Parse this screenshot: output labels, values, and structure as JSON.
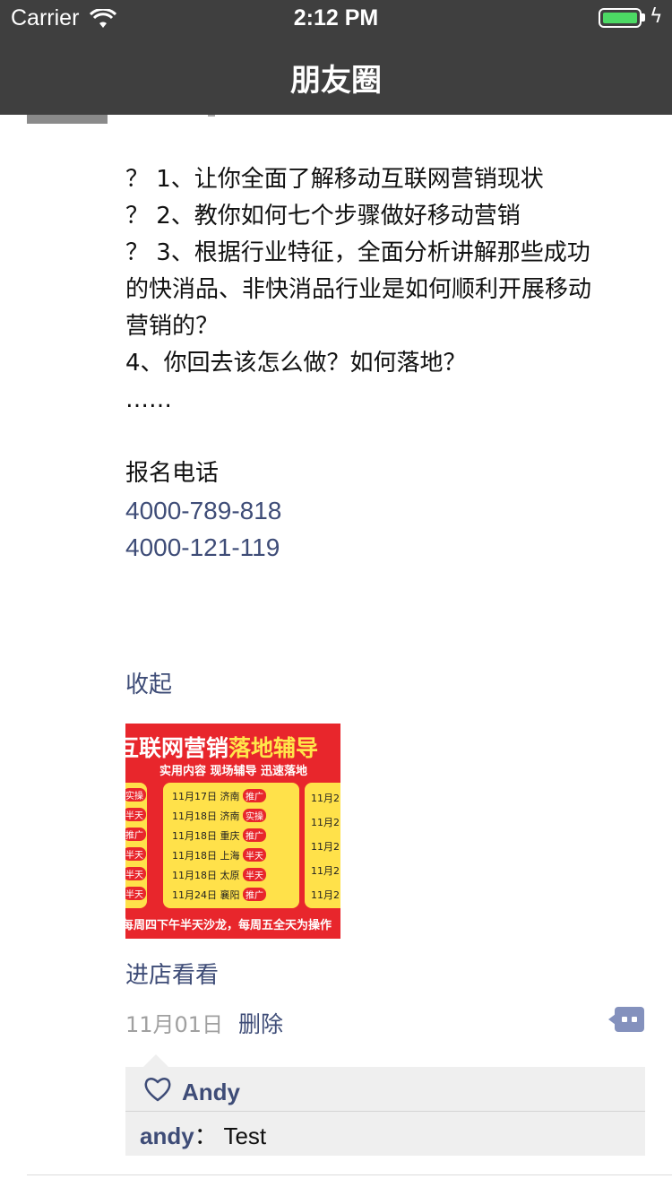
{
  "status_bar": {
    "carrier": "Carrier",
    "time": "2:12 PM",
    "battery_color": "#4cd964"
  },
  "nav": {
    "title": "朋友圈",
    "background": "#3f3f3f"
  },
  "post": {
    "lines": [
      "？ 1、让你全面了解移动互联网营销现状",
      "？ 2、教你如何七个步骤做好移动营销",
      "？ 3、根据行业特征，全面分析讲解那些成功",
      "的快消品、非快消品行业是如何顺利开展移动",
      "营销的？",
      "4、你回去该怎么做？如何落地？",
      "……",
      "",
      "报名电话"
    ],
    "phones": [
      "4000-789-818",
      "4000-121-119"
    ],
    "collapse_label": "收起",
    "ad_image": {
      "headline_white": "互联网营销",
      "headline_yellow": "落地辅导",
      "subtitle": "实用内容  现场辅导  迅速落地",
      "left_tags": [
        "实操",
        "半天",
        "推广",
        "半天",
        "半天",
        "半天"
      ],
      "middle_rows": [
        {
          "date": "11月17日",
          "city": "济南",
          "tag": "推广"
        },
        {
          "date": "11月18日",
          "city": "济南",
          "tag": "实操"
        },
        {
          "date": "11月18日",
          "city": "重庆",
          "tag": "推广"
        },
        {
          "date": "11月18日",
          "city": "上海",
          "tag": "半天"
        },
        {
          "date": "11月18日",
          "city": "太原",
          "tag": "半天"
        },
        {
          "date": "11月24日",
          "city": "襄阳",
          "tag": "推广"
        }
      ],
      "right_rows": [
        "11月2",
        "11月2",
        "11月2",
        "11月2",
        "11月2"
      ],
      "footer": "每周四下午半天沙龙，每周五全天为操作"
    },
    "shop_link": "进店看看",
    "date": "11月01日",
    "delete_label": "删除",
    "likes": [
      "Andy"
    ],
    "comments": [
      {
        "author": "andy",
        "separator": "：",
        "text": " Test"
      }
    ],
    "link_color": "#3e4c77"
  }
}
